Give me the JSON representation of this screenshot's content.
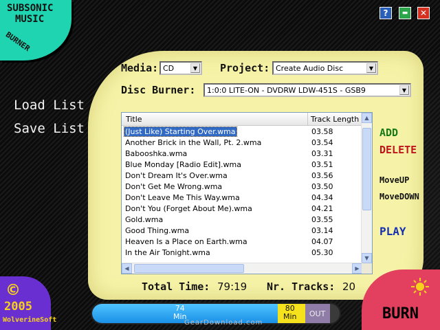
{
  "logo": {
    "line1": "SUBSONIC",
    "line2": "MUSIC",
    "line3": "BURNER"
  },
  "window_buttons": {
    "help": "?",
    "minimize": "▬",
    "close": "✕"
  },
  "left_menu": {
    "load": "Load List",
    "save": "Save List"
  },
  "media": {
    "label": "Media:",
    "value": "CD"
  },
  "project": {
    "label": "Project:",
    "value": "Create Audio Disc"
  },
  "burner": {
    "label": "Disc Burner:",
    "value": "1:0:0 LITE-ON  - DVDRW LDW-451S   - GSB9"
  },
  "list": {
    "columns": [
      "Title",
      "Track Length"
    ],
    "rows": [
      {
        "title": "(Just Like) Starting Over.wma",
        "length": "03.58"
      },
      {
        "title": "Another Brick in the Wall, Pt. 2.wma",
        "length": "03.54"
      },
      {
        "title": "Babooshka.wma",
        "length": "03.31"
      },
      {
        "title": "Blue Monday [Radio Edit].wma",
        "length": "03.51"
      },
      {
        "title": "Don't Dream It's Over.wma",
        "length": "03.56"
      },
      {
        "title": "Don't Get Me Wrong.wma",
        "length": "03.50"
      },
      {
        "title": "Don't Leave Me This Way.wma",
        "length": "04.34"
      },
      {
        "title": "Don't You (Forget About Me).wma",
        "length": "04.21"
      },
      {
        "title": "Gold.wma",
        "length": "03.55"
      },
      {
        "title": "Good Thing.wma",
        "length": "03.14"
      },
      {
        "title": "Heaven Is a Place on Earth.wma",
        "length": "04.07"
      },
      {
        "title": "In the Air Tonight.wma",
        "length": "05.30"
      }
    ]
  },
  "actions": {
    "add": "ADD",
    "delete": "DELETE",
    "move_up": "MoveUP",
    "move_down": "MoveDOWN",
    "play": "PLAY"
  },
  "totals": {
    "time_label": "Total Time:",
    "time_value": "79:19",
    "tracks_label": "Nr. Tracks:",
    "tracks_value": "20"
  },
  "credit": {
    "symbol": "©",
    "year": "2005",
    "company": "WolverineSoft"
  },
  "capacity": {
    "m74_num": "74",
    "m74_unit": "Min",
    "m80_num": "80",
    "m80_unit": "Min",
    "out": "OUT"
  },
  "burn_label": "BURN",
  "watermark": "GearDownload.com",
  "colors": {
    "panel": "#f6f3a8",
    "add": "#1a7a1a",
    "delete": "#c0141c",
    "move": "#111111",
    "play": "#1530b0"
  }
}
